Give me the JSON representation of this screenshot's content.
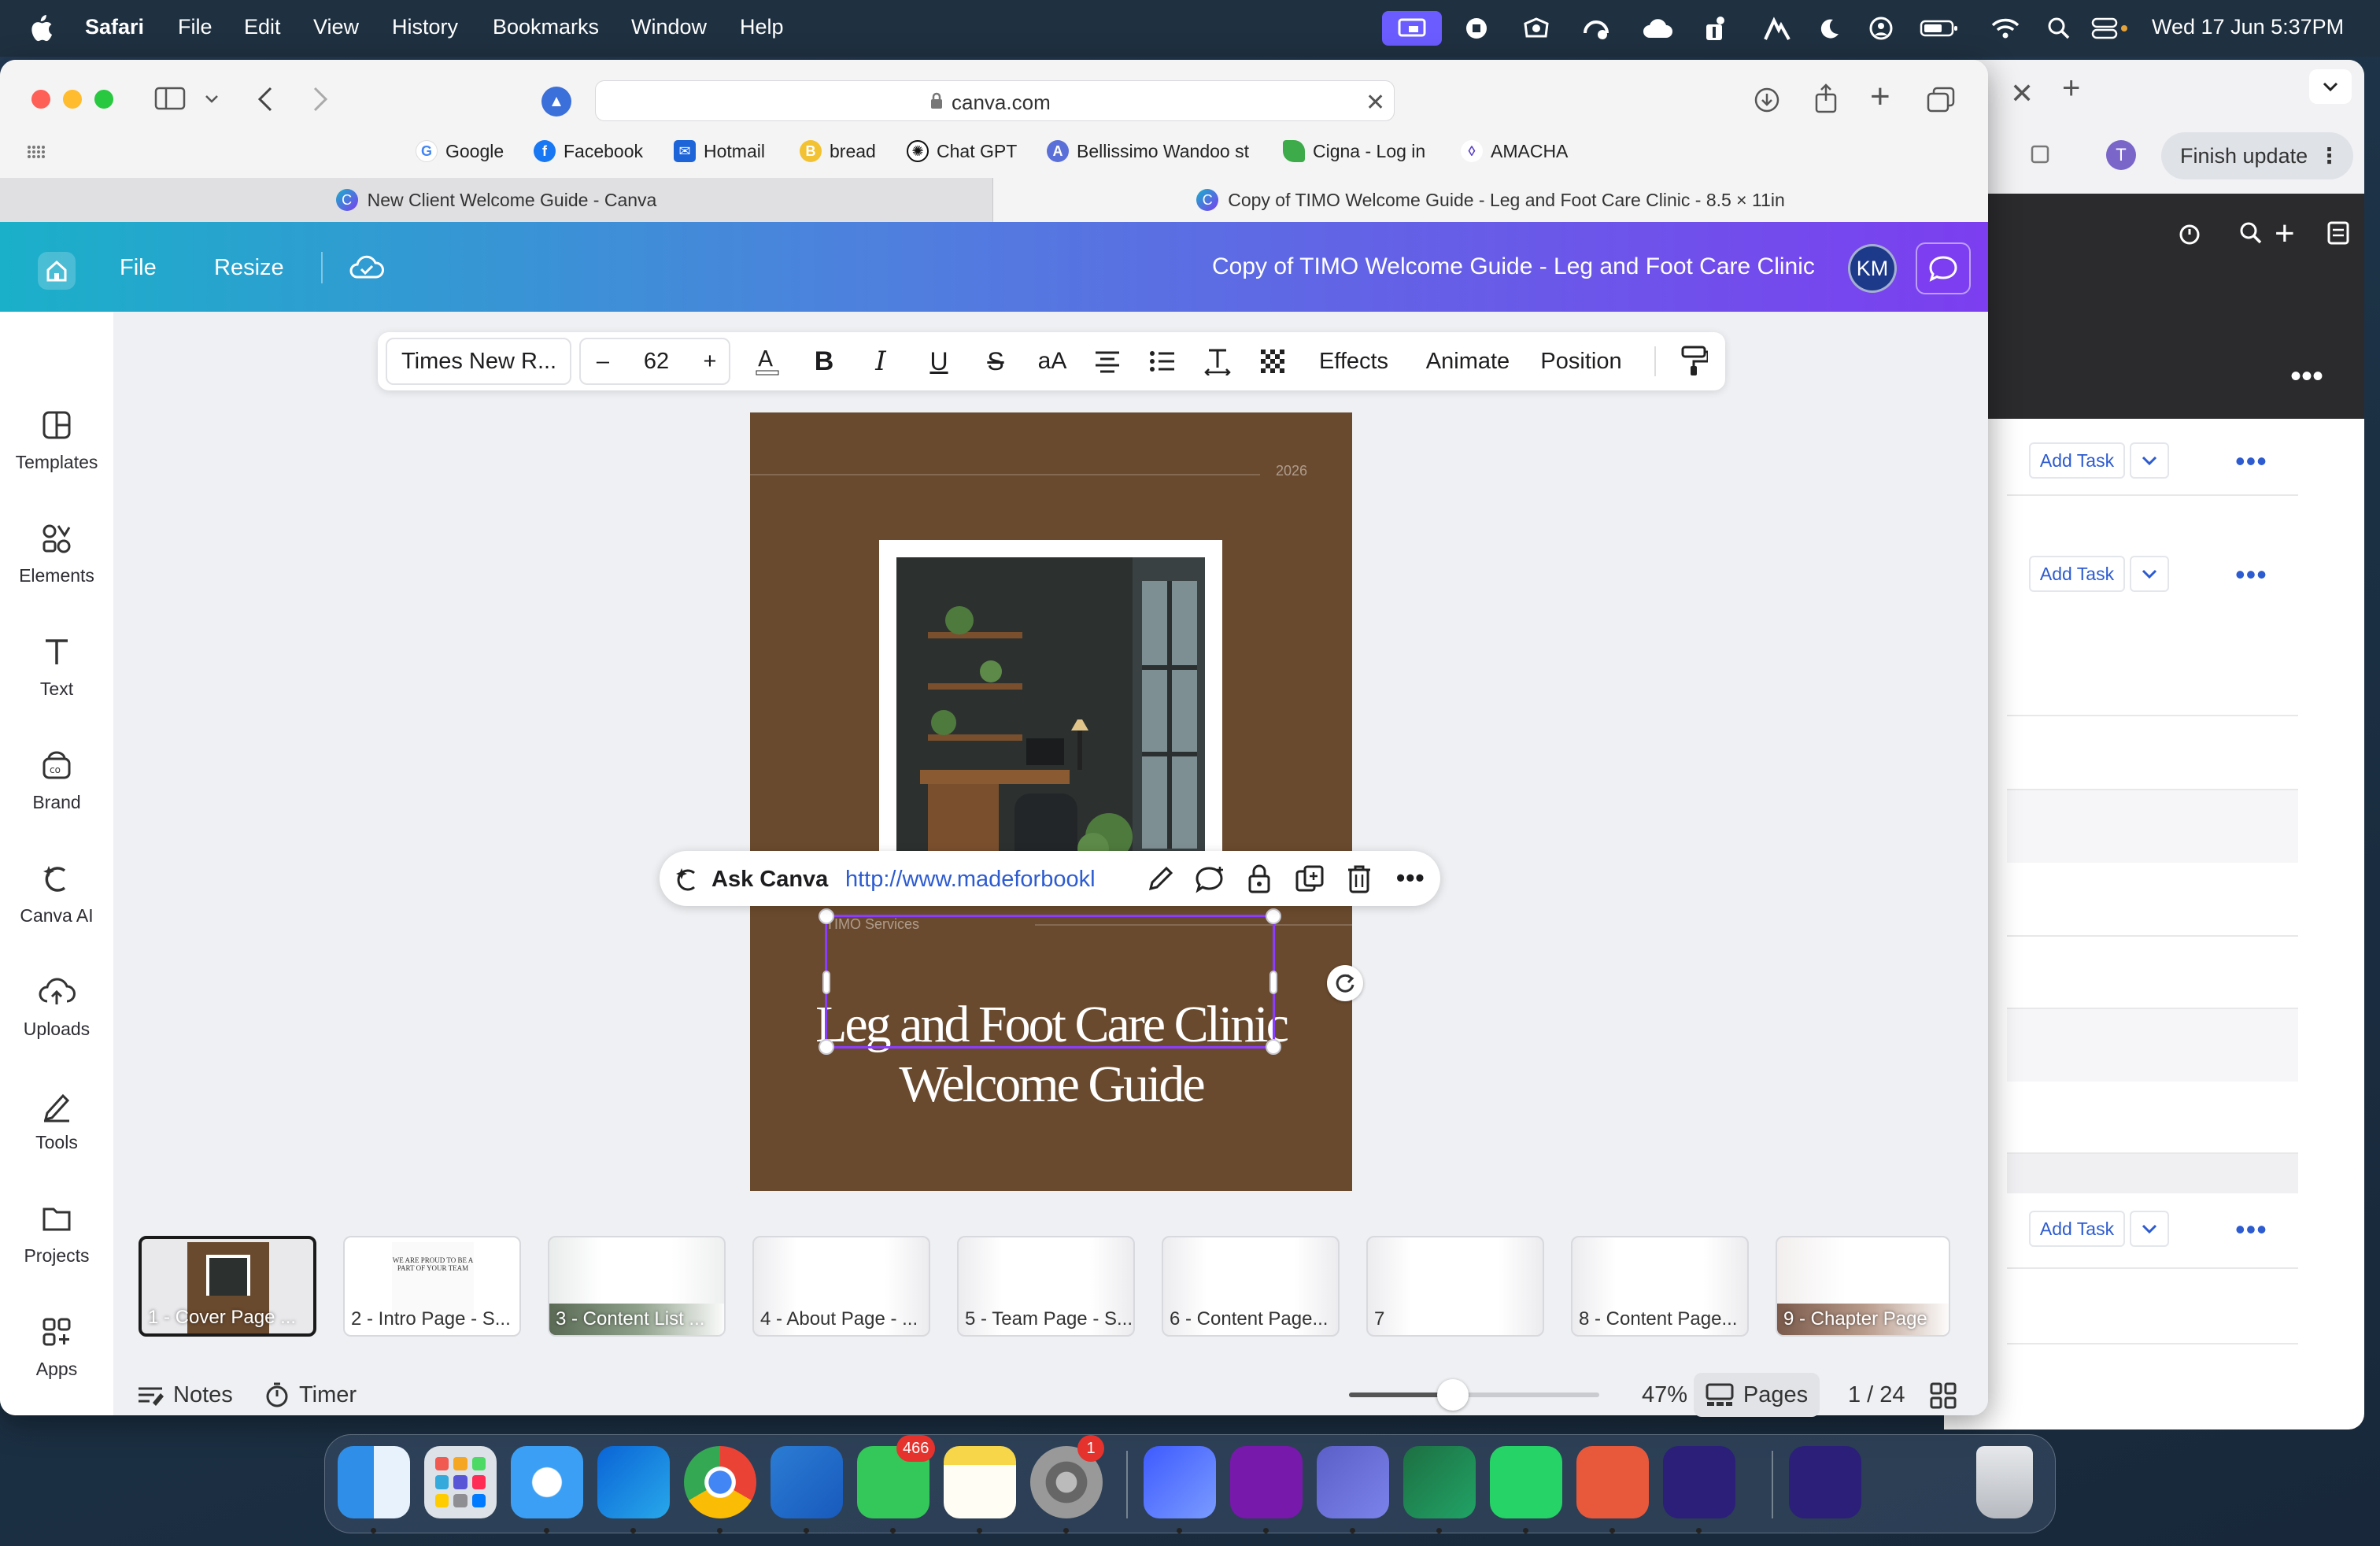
{
  "menubar": {
    "app": "Safari",
    "items": [
      "File",
      "Edit",
      "View",
      "History",
      "Bookmarks",
      "Window",
      "Help"
    ],
    "datetime": "Wed 17 Jun  5:37PM"
  },
  "safari": {
    "address": "canva.com",
    "bookmarks": [
      "Google",
      "Facebook",
      "Hotmail",
      "bread",
      "Chat GPT",
      "Bellissimo Wandoo st",
      "Cigna - Log in",
      "AMACHA"
    ],
    "tabs": [
      {
        "title": "New Client Welcome Guide - Canva",
        "active": false
      },
      {
        "title": "Copy of TIMO Welcome Guide - Leg and Foot Care Clinic - 8.5 × 11in",
        "active": true
      }
    ]
  },
  "back_window": {
    "finish_update": "Finish update",
    "add_task_label": "Add Task"
  },
  "canva": {
    "header": {
      "file": "File",
      "resize": "Resize",
      "doc_title": "Copy of TIMO Welcome Guide - Leg and Foot Care Clinic",
      "avatar": "KM"
    },
    "sidebar": [
      "Templates",
      "Elements",
      "Text",
      "Brand",
      "Canva AI",
      "Uploads",
      "Tools",
      "Projects",
      "Apps"
    ],
    "format_bar": {
      "font": "Times New R...",
      "size": "62",
      "minus": "–",
      "plus": "+",
      "effects": "Effects",
      "animate": "Animate",
      "position": "Position"
    },
    "page": {
      "year": "2026",
      "title_line1": "Leg and Foot Care Clinic",
      "title_line2": "Welcome Guide",
      "footer": "TIMO Services"
    },
    "context_bar": {
      "ask": "Ask Canva",
      "link": "http://www.madeforbookl"
    },
    "thumbnails": [
      "1 - Cover Page ...",
      "2 - Intro Page - S...",
      "3 - Content List ...",
      "4 - About Page - ...",
      "5 - Team Page - S...",
      "6 - Content Page...",
      "7",
      "8 - Content Page...",
      "9 - Chapter Page"
    ],
    "thumb_intro_text": "WE ARE PROUD TO BE A PART OF YOUR TEAM",
    "footer": {
      "notes": "Notes",
      "timer": "Timer",
      "zoom_percent": "47%",
      "zoom_value": 0.47,
      "pages": "Pages",
      "page_count": "1 / 24"
    }
  },
  "dock": {
    "messages_badge": "466",
    "settings_badge": "1"
  },
  "colors": {
    "page_brown": "#6a4a2e",
    "selection": "#8b3dff",
    "header_start": "#1ab0c9",
    "header_end": "#7c3ef0",
    "link_blue": "#2d5bd0"
  }
}
